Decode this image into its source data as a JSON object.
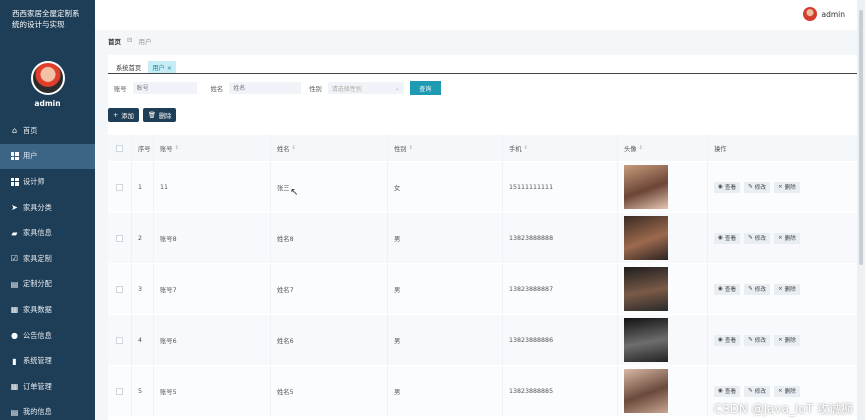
{
  "app": {
    "title": "西西家居全屋定制系统的设计与实现",
    "user": "admin"
  },
  "sidebar": {
    "username": "admin",
    "items": [
      {
        "label": "首页",
        "icon": "home-icon"
      },
      {
        "label": "用户",
        "icon": "grid-icon",
        "active": true
      },
      {
        "label": "设计师",
        "icon": "grid-icon"
      },
      {
        "label": "家具分类",
        "icon": "send-icon"
      },
      {
        "label": "家具信息",
        "icon": "briefcase-icon"
      },
      {
        "label": "家具定制",
        "icon": "checkbox-icon"
      },
      {
        "label": "定制分配",
        "icon": "document-icon"
      },
      {
        "label": "家具数据",
        "icon": "clipboard-icon"
      },
      {
        "label": "公告信息",
        "icon": "pin-icon"
      },
      {
        "label": "系统管理",
        "icon": "chart-icon"
      },
      {
        "label": "订单管理",
        "icon": "clipboard-icon"
      },
      {
        "label": "我的信息",
        "icon": "document-icon"
      }
    ]
  },
  "breadcrumb": {
    "home": "首页",
    "sep": "⊟",
    "current": "用户"
  },
  "tabs": [
    {
      "label": "系统首页"
    },
    {
      "label": "用户",
      "close": "×",
      "active": true
    }
  ],
  "search": {
    "account_label": "账号",
    "account_placeholder": "账号",
    "name_label": "姓名",
    "name_placeholder": "姓名",
    "gender_label": "性别",
    "gender_placeholder": "请选择性别",
    "query_button": "查询"
  },
  "toolbar": {
    "add": "添加",
    "delete": "删除"
  },
  "table": {
    "headers": [
      "序号",
      "账号",
      "姓名",
      "性别",
      "手机",
      "头像",
      "操作"
    ],
    "ops": {
      "view": "查看",
      "edit": "修改",
      "delete": "删除"
    },
    "rows": [
      {
        "idx": "1",
        "account": "11",
        "name": "张三",
        "gender": "女",
        "phone": "15111111111"
      },
      {
        "idx": "2",
        "account": "账号8",
        "name": "姓名8",
        "gender": "男",
        "phone": "13823888888"
      },
      {
        "idx": "3",
        "account": "账号7",
        "name": "姓名7",
        "gender": "男",
        "phone": "13823888887"
      },
      {
        "idx": "4",
        "account": "账号6",
        "name": "姓名6",
        "gender": "男",
        "phone": "13823888886"
      },
      {
        "idx": "5",
        "account": "账号5",
        "name": "姓名5",
        "gender": "男",
        "phone": "13823888885"
      }
    ]
  },
  "watermark": "CSDN @Java_IoT 攻诚狮"
}
